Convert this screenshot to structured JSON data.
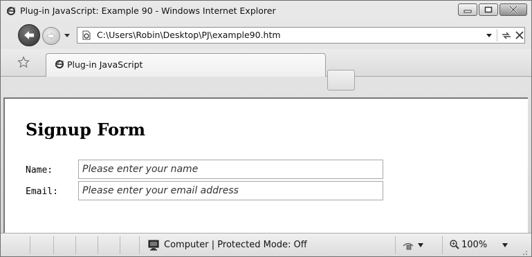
{
  "window": {
    "title": "Plug-in JavaScript: Example 90 - Windows Internet Explorer",
    "controls": [
      "minimize-icon",
      "maximize-icon",
      "close-icon"
    ]
  },
  "nav": {
    "address": "C:\\Users\\Robin\\Desktop\\PJ\\example90.htm"
  },
  "tabs": [
    {
      "label": "Plug-in JavaScript",
      "active": true
    }
  ],
  "page": {
    "title": "Signup Form",
    "form": {
      "name_label": "Name: ",
      "name_placeholder": "Please enter your name",
      "email_label": "Email:",
      "email_placeholder": "Please enter your email address"
    }
  },
  "status": {
    "zone_text": "Computer | Protected Mode: Off",
    "zoom": "100%"
  },
  "colors": {
    "chrome": "#d9d9d9",
    "content_bg": "#ffffff"
  }
}
